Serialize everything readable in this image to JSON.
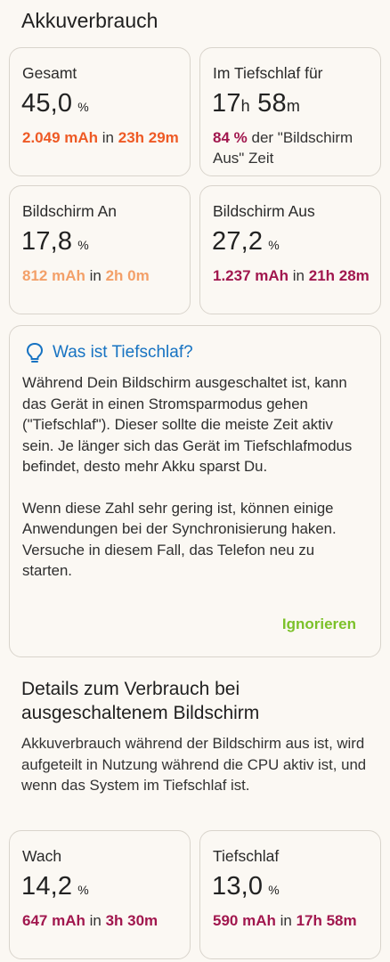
{
  "header": {
    "title": "Akkuverbrauch"
  },
  "cards": {
    "total": {
      "label": "Gesamt",
      "value": "45,0",
      "unit": "%",
      "mah": "2.049 mAh",
      "in": "in",
      "duration": "23h 29m"
    },
    "deep_sleep": {
      "label": "Im Tiefschlaf für",
      "hours": "17",
      "hours_unit": "h",
      "minutes": "58",
      "minutes_unit": "m",
      "percent": "84 %",
      "suffix": "der \"Bildschirm Aus\" Zeit"
    },
    "screen_on": {
      "label": "Bildschirm An",
      "value": "17,8",
      "unit": "%",
      "mah": "812 mAh",
      "in": "in",
      "duration": "2h 0m"
    },
    "screen_off": {
      "label": "Bildschirm Aus",
      "value": "27,2",
      "unit": "%",
      "mah": "1.237 mAh",
      "in": "in",
      "duration": "21h 28m"
    },
    "awake": {
      "label": "Wach",
      "value": "14,2",
      "unit": "%",
      "mah": "647 mAh",
      "in": "in",
      "duration": "3h 30m"
    },
    "sleep": {
      "label": "Tiefschlaf",
      "value": "13,0",
      "unit": "%",
      "mah": "590 mAh",
      "in": "in",
      "duration": "17h 58m"
    }
  },
  "tip": {
    "icon": "lightbulb-icon",
    "title": "Was ist Tiefschlaf?",
    "paragraph1": "Während Dein Bildschirm ausgeschaltet ist, kann das Gerät in einen Stromsparmodus gehen (\"Tiefschlaf\"). Dieser sollte die meiste Zeit aktiv sein. Je länger sich das Gerät im Tiefschlafmodus befindet, desto mehr Akku sparst Du.",
    "paragraph2": "Wenn diese Zahl sehr gering ist, können einige Anwendungen bei der Synchronisierung haken. Versuche in diesem Fall, das Telefon neu zu starten.",
    "dismiss_label": "Ignorieren"
  },
  "details": {
    "title": "Details zum Verbrauch bei ausgeschaltenem Bildschirm",
    "description": "Akkuverbrauch während der Bildschirm aus ist, wird aufgeteilt in Nutzung während die CPU aktiv ist, und wenn das System im Tiefschlaf ist."
  },
  "colors": {
    "orange": "#ee5a25",
    "peach": "#f3a069",
    "wine": "#a1174e",
    "link_blue": "#1773c2",
    "action_green": "#7cc12a"
  }
}
